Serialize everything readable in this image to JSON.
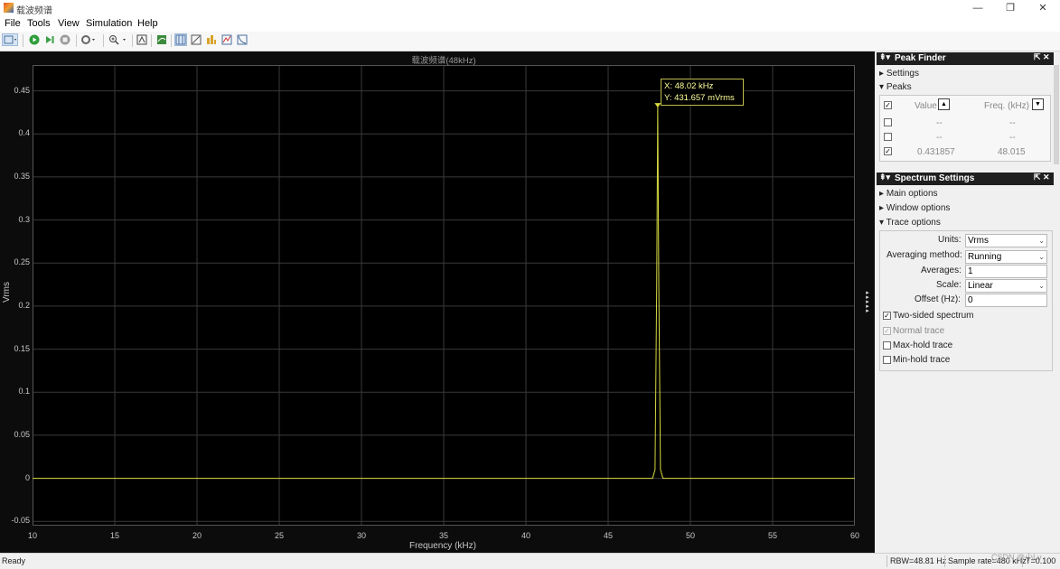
{
  "window": {
    "title": "载波频谱",
    "minimize": "—",
    "maximize": "❐",
    "close": "✕"
  },
  "menu": [
    "File",
    "Tools",
    "View",
    "Simulation",
    "Help"
  ],
  "plot": {
    "title": "载波频谱(48kHz)",
    "ylabel": "Vrms",
    "xlabel": "Frequency (kHz)",
    "datatip": {
      "x_line": "X: 48.02 kHz",
      "y_line": "Y:  431.657 mVrms"
    }
  },
  "chart_data": {
    "type": "line",
    "xlim": [
      10,
      60
    ],
    "ylim": [
      -0.055,
      0.48
    ],
    "xticks": [
      "10",
      "15",
      "20",
      "25",
      "30",
      "35",
      "40",
      "45",
      "50",
      "55",
      "60"
    ],
    "yticks": [
      "0.45",
      "0.4",
      "0.35",
      "0.3",
      "0.25",
      "0.2",
      "0.15",
      "0.1",
      "0.05",
      "0",
      "-0.05"
    ],
    "grid": true,
    "color": "#d8d840",
    "peak": {
      "x": 48.015,
      "y": 0.431657
    },
    "series": [
      {
        "x": [
          10,
          47.7,
          47.85,
          47.95,
          48.015,
          48.08,
          48.18,
          48.33,
          60
        ],
        "y": [
          0,
          0,
          0.01,
          0.22,
          0.431657,
          0.22,
          0.01,
          0,
          0
        ]
      }
    ]
  },
  "peak_finder": {
    "header": "Peak Finder",
    "settings_label": "Settings",
    "peaks_label": "Peaks",
    "col_value": "Value",
    "col_freq": "Freq. (kHz)",
    "rows": [
      {
        "value": "--",
        "freq": "--"
      },
      {
        "value": "--",
        "freq": "--"
      },
      {
        "value": "0.431857",
        "freq": "48.015"
      }
    ]
  },
  "spectrum_settings": {
    "header": "Spectrum Settings",
    "main_options": "Main options",
    "window_options": "Window options",
    "trace_options": "Trace options",
    "units_label": "Units:",
    "units_value": "Vrms",
    "avg_method_label": "Averaging method:",
    "avg_method_value": "Running",
    "averages_label": "Averages:",
    "averages_value": "1",
    "scale_label": "Scale:",
    "scale_value": "Linear",
    "offset_label": "Offset (Hz):",
    "offset_value": "0",
    "two_sided": "Two-sided spectrum",
    "normal_trace": "Normal trace",
    "max_hold": "Max-hold trace",
    "min_hold": "Min-hold trace"
  },
  "status": {
    "ready": "Ready",
    "rbw": "RBW=48.81 Hz",
    "sample_rate": "Sample rate=480 kHz",
    "time": "T=0.100",
    "watermark": "CSDN @小Lv"
  },
  "colors": {
    "plot_bg": "#000000",
    "trace": "#d8d840",
    "grid": "#3a3a3a",
    "panel_header": "#1f1f1f"
  }
}
